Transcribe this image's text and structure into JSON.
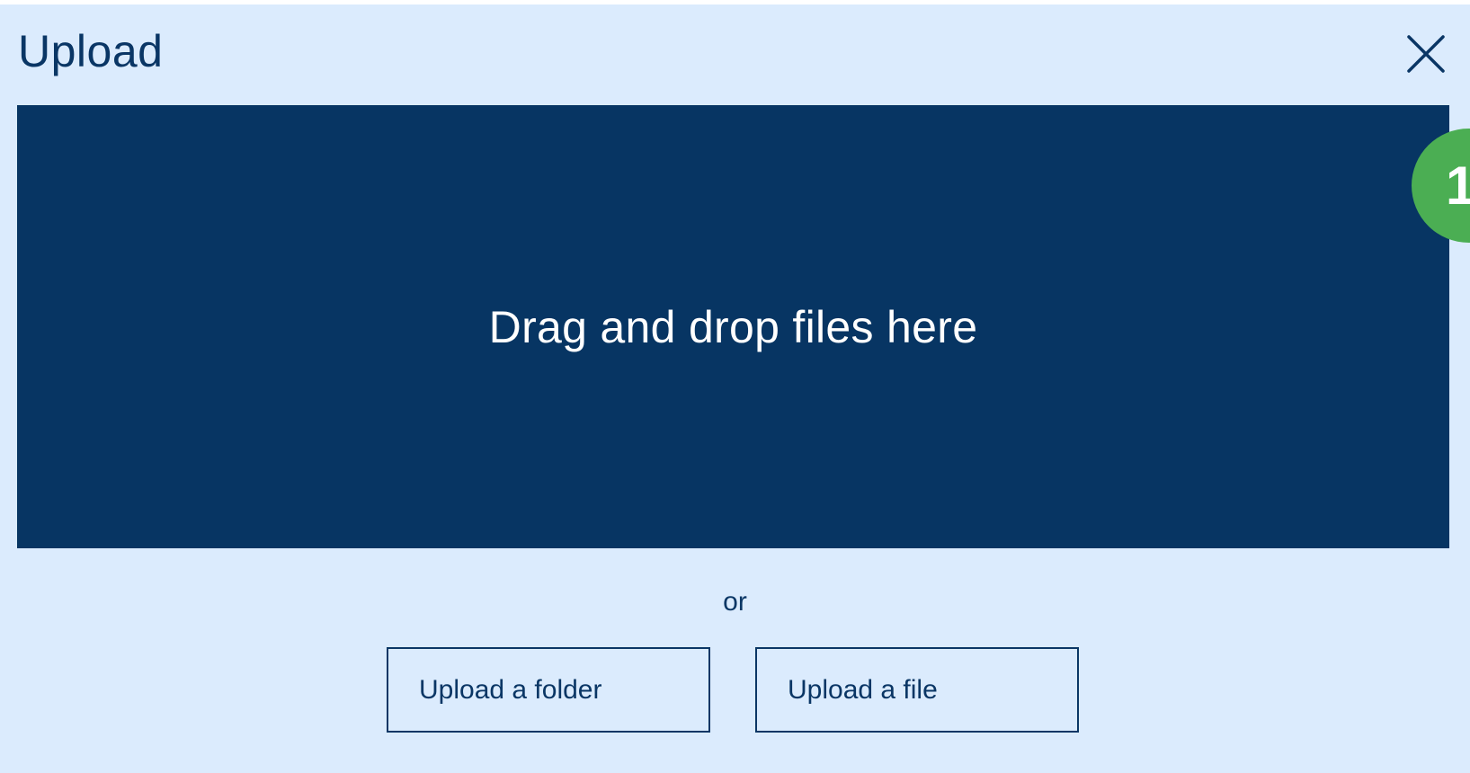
{
  "dialog": {
    "title": "Upload",
    "close_icon": "close-icon"
  },
  "dropzone": {
    "label": "Drag and drop files here"
  },
  "badge": {
    "number": "1",
    "color": "#4bae53"
  },
  "separator": {
    "label": "or"
  },
  "actions": {
    "upload_folder_label": "Upload a folder",
    "upload_file_label": "Upload a file"
  },
  "colors": {
    "background": "#dbebfd",
    "dropzone": "#073563",
    "text": "#0a3665"
  }
}
